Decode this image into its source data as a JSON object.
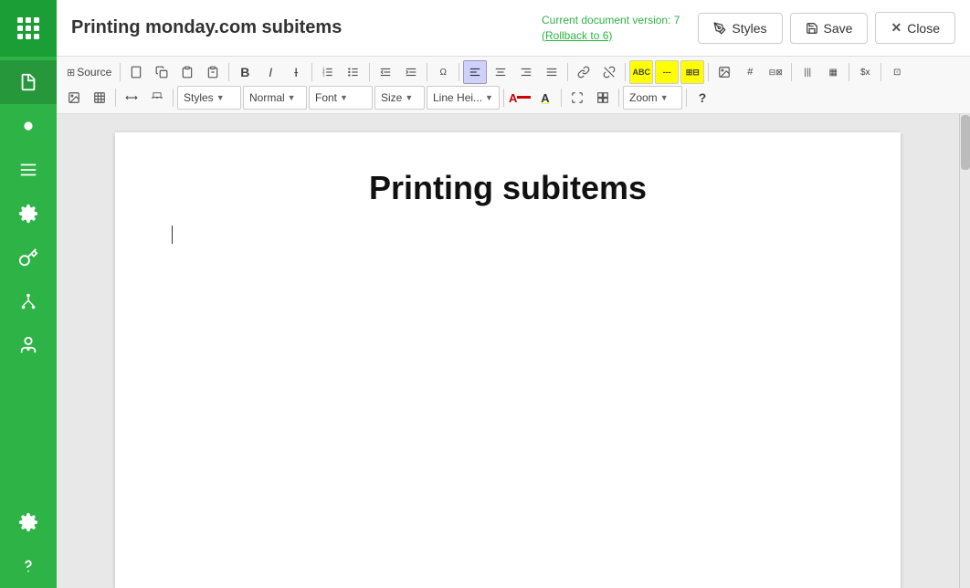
{
  "app": {
    "title": "Printing monday.com subitems"
  },
  "topbar": {
    "title": "Printing monday.com subitems",
    "version_line1": "Current document version: 7",
    "version_line2": "(Rollback to 6)",
    "styles_label": "Styles",
    "save_label": "Save",
    "close_label": "Close"
  },
  "toolbar": {
    "row1": {
      "source": "Source",
      "styles_label": "Styles",
      "normal_label": "Normal",
      "font_label": "Font",
      "size_label": "Size",
      "line_height_label": "Line Hei..."
    }
  },
  "editor": {
    "heading": "Printing subitems"
  },
  "sidebar": {
    "items": [
      {
        "name": "document",
        "label": "Document"
      },
      {
        "name": "brightness",
        "label": "Brightness"
      },
      {
        "name": "list",
        "label": "List"
      },
      {
        "name": "settings",
        "label": "Settings"
      },
      {
        "name": "key",
        "label": "Key"
      },
      {
        "name": "hierarchy",
        "label": "Hierarchy"
      },
      {
        "name": "user-download",
        "label": "User Download"
      },
      {
        "name": "settings-bottom",
        "label": "Settings Bottom"
      },
      {
        "name": "help",
        "label": "Help"
      }
    ]
  }
}
